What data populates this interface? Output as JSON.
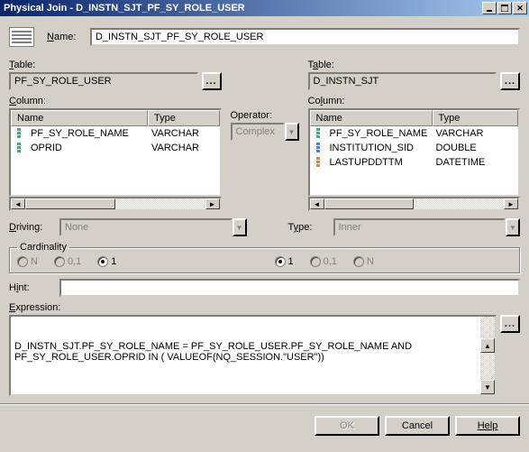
{
  "window": {
    "title": "Physical Join - D_INSTN_SJT_PF_SY_ROLE_USER"
  },
  "name_label": "Name:",
  "name_value": "D_INSTN_SJT_PF_SY_ROLE_USER",
  "left": {
    "table_label": "Table:",
    "table_value": "PF_SY_ROLE_USER",
    "column_label": "Column:",
    "headers": {
      "name": "Name",
      "type": "Type"
    },
    "rows": [
      {
        "name": "PF_SY_ROLE_NAME",
        "type": "VARCHAR"
      },
      {
        "name": "OPRID",
        "type": "VARCHAR"
      }
    ]
  },
  "right": {
    "table_label": "Table:",
    "table_value": "D_INSTN_SJT",
    "column_label": "Column:",
    "headers": {
      "name": "Name",
      "type": "Type"
    },
    "rows": [
      {
        "name": "PF_SY_ROLE_NAME",
        "type": "VARCHAR"
      },
      {
        "name": "INSTITUTION_SID",
        "type": "DOUBLE"
      },
      {
        "name": "LASTUPDDTTM",
        "type": "DATETIME"
      }
    ]
  },
  "operator_label": "Operator:",
  "operator_value": "Complex",
  "driving_label": "Driving:",
  "driving_value": "None",
  "type_label": "Type:",
  "type_value": "Inner",
  "cardinality": {
    "legend": "Cardinality",
    "left": {
      "n": "N",
      "z1": "0,1",
      "one": "1"
    },
    "right": {
      "one": "1",
      "z1": "0,1",
      "n": "N"
    }
  },
  "hint_label": "Hint:",
  "hint_value": "",
  "expression_label": "Expression:",
  "expression_value": "D_INSTN_SJT.PF_SY_ROLE_NAME = PF_SY_ROLE_USER.PF_SY_ROLE_NAME AND\nPF_SY_ROLE_USER.OPRID IN ( VALUEOF(NQ_SESSION.\"USER\"))",
  "buttons": {
    "ok": "OK",
    "cancel": "Cancel",
    "help": "Help"
  },
  "ellipsis": "..."
}
